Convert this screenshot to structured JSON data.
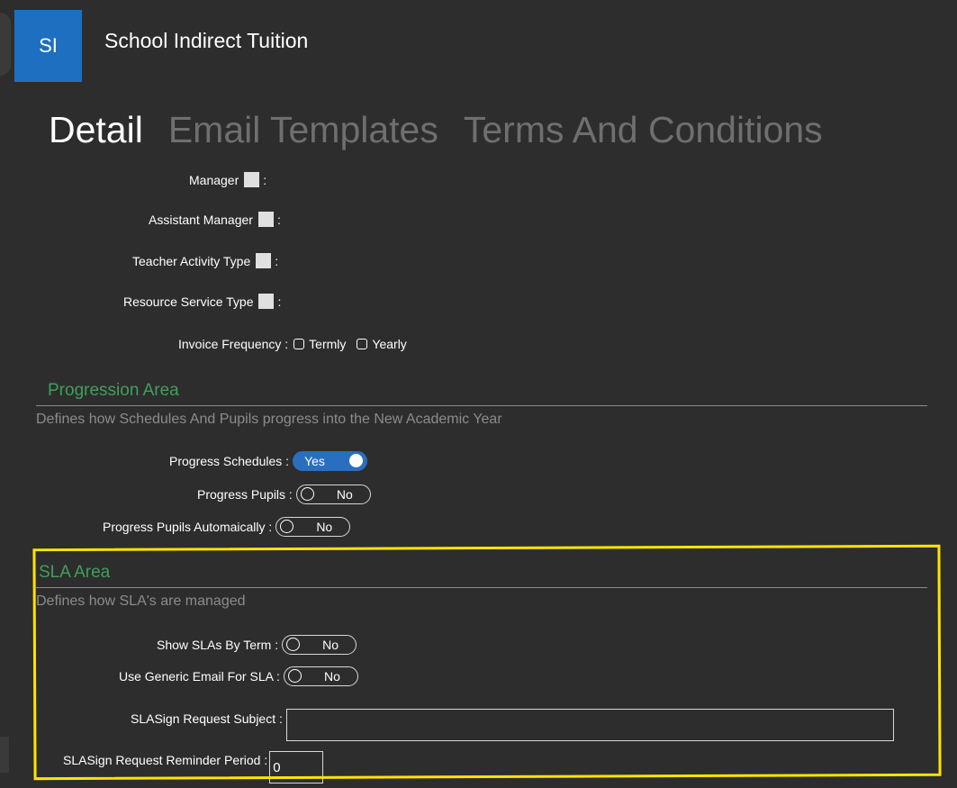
{
  "app": {
    "avatar_initials": "SI",
    "title": "School Indirect Tuition"
  },
  "tabs": [
    {
      "label": "Detail",
      "active": true
    },
    {
      "label": "Email Templates",
      "active": false
    },
    {
      "label": "Terms And Conditions",
      "active": false
    }
  ],
  "fields": {
    "manager": "Manager",
    "assistant_manager": "Assistant Manager",
    "teacher_activity_type": "Teacher Activity Type",
    "resource_service_type": "Resource Service Type",
    "invoice_frequency": "Invoice Frequency :",
    "invoice_options": [
      "Termly",
      "Yearly"
    ],
    "colon": ":"
  },
  "progression": {
    "title": "Progression Area",
    "description": "Defines how Schedules And Pupils progress into the New Academic Year",
    "progress_schedules": {
      "label": "Progress Schedules :",
      "value": "Yes"
    },
    "progress_pupils": {
      "label": "Progress Pupils :",
      "value": "No"
    },
    "progress_pupils_auto": {
      "label": "Progress Pupils Automaically :",
      "value": "No"
    }
  },
  "sla": {
    "title": "SLA Area",
    "description": "Defines how SLA's are managed",
    "show_by_term": {
      "label": "Show SLAs By Term :",
      "value": "No"
    },
    "generic_email": {
      "label": "Use Generic Email For SLA :",
      "value": "No"
    },
    "request_subject": {
      "label": "SLASign Request Subject :",
      "value": ""
    },
    "reminder_period": {
      "label": "SLASign Request Reminder Period :",
      "value": "0"
    }
  },
  "colors": {
    "accent": "#1f6fc0",
    "section": "#3fa05a",
    "highlight": "#ffe400",
    "background": "#2d2d2d"
  }
}
